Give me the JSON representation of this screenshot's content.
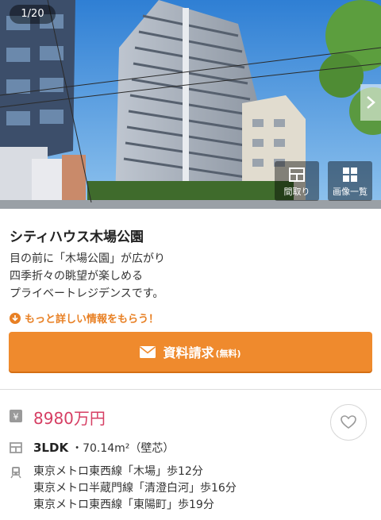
{
  "gallery": {
    "counter": "1/20",
    "floor_plan_label": "間取り",
    "gallery_list_label": "画像一覧"
  },
  "property": {
    "name": "シティハウス木場公園",
    "description": "目の前に「木場公園」が広がり\n四季折々の眺望が楽しめる\nプライベートレジデンスです。",
    "more_info_link": "もっと詳しい情報をもらう！",
    "request_button": {
      "label": "資料請求",
      "sub_label": "(無料)"
    },
    "price": "8980万円",
    "layout_type": "3LDK",
    "layout_detail": "・70.14m²（壁芯）",
    "stations": [
      "東京メトロ東西線「木場」歩12分",
      "東京メトロ半蔵門線「清澄白河」歩16分",
      "東京メトロ東西線「東陽町」歩19分"
    ]
  },
  "colors": {
    "accent": "#ef8a2d",
    "price": "#d63e63",
    "link": "#e88024"
  },
  "icons": [
    "chevron-right-icon",
    "floor-plan-icon",
    "grid-icon",
    "download-icon",
    "mail-icon",
    "yen-icon",
    "layout-icon",
    "train-icon",
    "heart-icon"
  ]
}
